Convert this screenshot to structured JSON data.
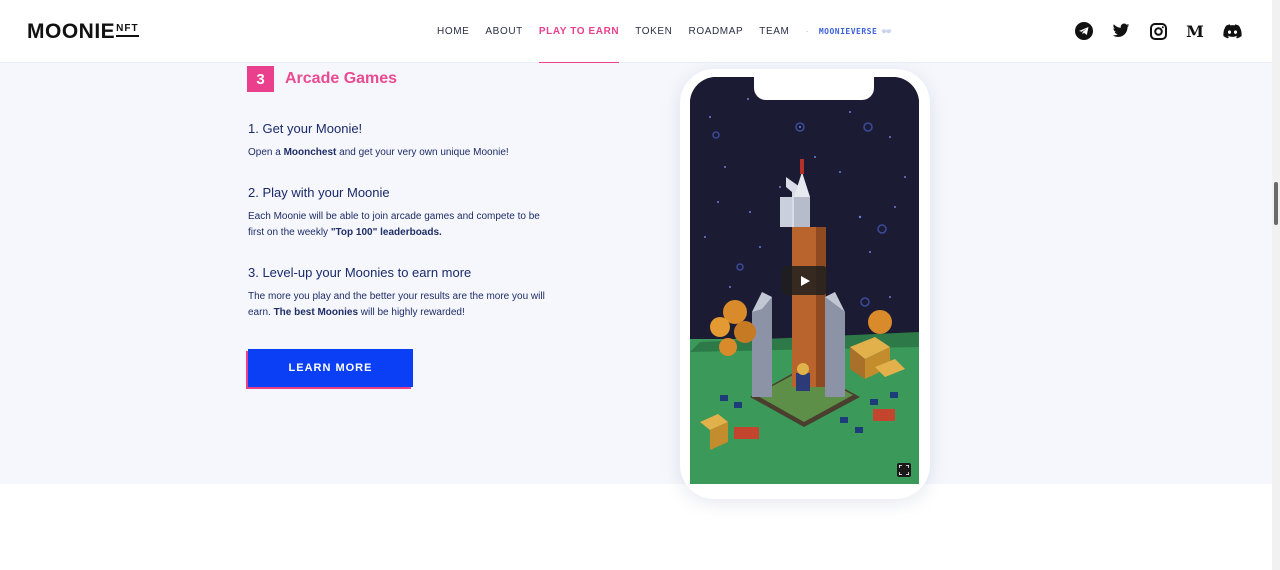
{
  "header": {
    "logo_main": "MOONIE",
    "logo_sub": "NFT",
    "nav": [
      {
        "label": "HOME"
      },
      {
        "label": "ABOUT"
      },
      {
        "label": "PLAY TO EARN"
      },
      {
        "label": "TOKEN"
      },
      {
        "label": "ROADMAP"
      },
      {
        "label": "TEAM"
      }
    ],
    "nav_sep": "·",
    "nav_special": "MOONIEVERSE",
    "nav_special_faint": "🕶",
    "socials": [
      "telegram-icon",
      "twitter-icon",
      "instagram-icon",
      "medium-icon",
      "discord-icon"
    ]
  },
  "section": {
    "number": "3",
    "title": "Arcade Games",
    "steps": [
      {
        "title": "1. Get your Moonie!",
        "text_a": "Open a ",
        "bold_a": "Moonchest",
        "text_b": " and get your very own unique Moonie!"
      },
      {
        "title": "2. Play with your Moonie",
        "text_a": "Each Moonie will be able to join arcade games and compete to be first on the weekly ",
        "bold_a": "\"Top 100\" leaderboads."
      },
      {
        "title": "3. Level-up your Moonies to earn more",
        "text_a": "The more you play and the better your results are the more you will earn. ",
        "bold_a": "The best Moonies",
        "text_b": " will be highly rewarded!"
      }
    ],
    "button_label": "LEARN MORE"
  },
  "colors": {
    "accent_pink": "#ea3f8c",
    "button_blue": "#0b3ff5",
    "text_navy": "#1b2a6b",
    "band_bg": "#f5f7fc"
  },
  "video": {
    "play_icon": "play-icon",
    "fullscreen_icon": "fullscreen-icon"
  }
}
